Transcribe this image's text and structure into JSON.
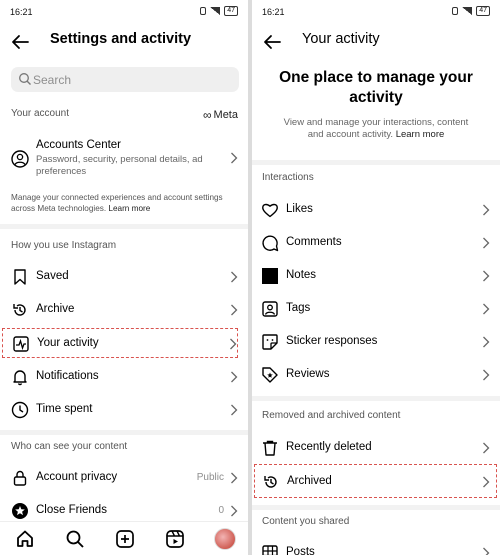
{
  "left": {
    "status": {
      "time": "16:21",
      "battery": "47"
    },
    "title": "Settings and activity",
    "search_placeholder": "Search",
    "your_account": {
      "label": "Your account",
      "meta": "Meta"
    },
    "accounts_center": {
      "title": "Accounts Center",
      "desc": "Password, security, personal details, ad preferences"
    },
    "note": "Manage your connected experiences and account settings across Meta technologies.",
    "note_link": "Learn more",
    "how_you_use": "How you use Instagram",
    "items": [
      {
        "label": "Saved",
        "icon": "bookmark-icon"
      },
      {
        "label": "Archive",
        "icon": "archive-icon"
      },
      {
        "label": "Your activity",
        "icon": "activity-icon"
      },
      {
        "label": "Notifications",
        "icon": "bell-icon"
      },
      {
        "label": "Time spent",
        "icon": "clock-icon"
      }
    ],
    "who_can_see": "Who can see your content",
    "privacy_items": [
      {
        "label": "Account privacy",
        "value": "Public",
        "icon": "lock-icon"
      },
      {
        "label": "Close Friends",
        "value": "0",
        "icon": "star-icon"
      }
    ],
    "tabs": [
      "home-icon",
      "search-icon",
      "create-icon",
      "reels-icon",
      "profile-avatar"
    ]
  },
  "right": {
    "status": {
      "time": "16:21",
      "battery": "47"
    },
    "title": "Your activity",
    "hero": "One place to manage your activity",
    "hero_sub": "View and manage your interactions, content and account activity.",
    "hero_link": "Learn more",
    "interactions": "Interactions",
    "interaction_items": [
      {
        "label": "Likes",
        "icon": "heart-icon"
      },
      {
        "label": "Comments",
        "icon": "comment-icon"
      },
      {
        "label": "Notes",
        "icon": "note-icon"
      },
      {
        "label": "Tags",
        "icon": "tag-icon"
      },
      {
        "label": "Sticker responses",
        "icon": "sticker-icon"
      },
      {
        "label": "Reviews",
        "icon": "review-icon"
      }
    ],
    "removed_archived": "Removed and archived content",
    "removed_items": [
      {
        "label": "Recently deleted",
        "icon": "trash-icon"
      },
      {
        "label": "Archived",
        "icon": "archive-icon"
      }
    ],
    "content_shared": "Content you shared",
    "shared_items": [
      {
        "label": "Posts",
        "icon": "grid-icon"
      }
    ]
  },
  "colors": {
    "highlight": "#d9534f",
    "muted": "#8e8e8e",
    "search_bg": "#efefef"
  }
}
